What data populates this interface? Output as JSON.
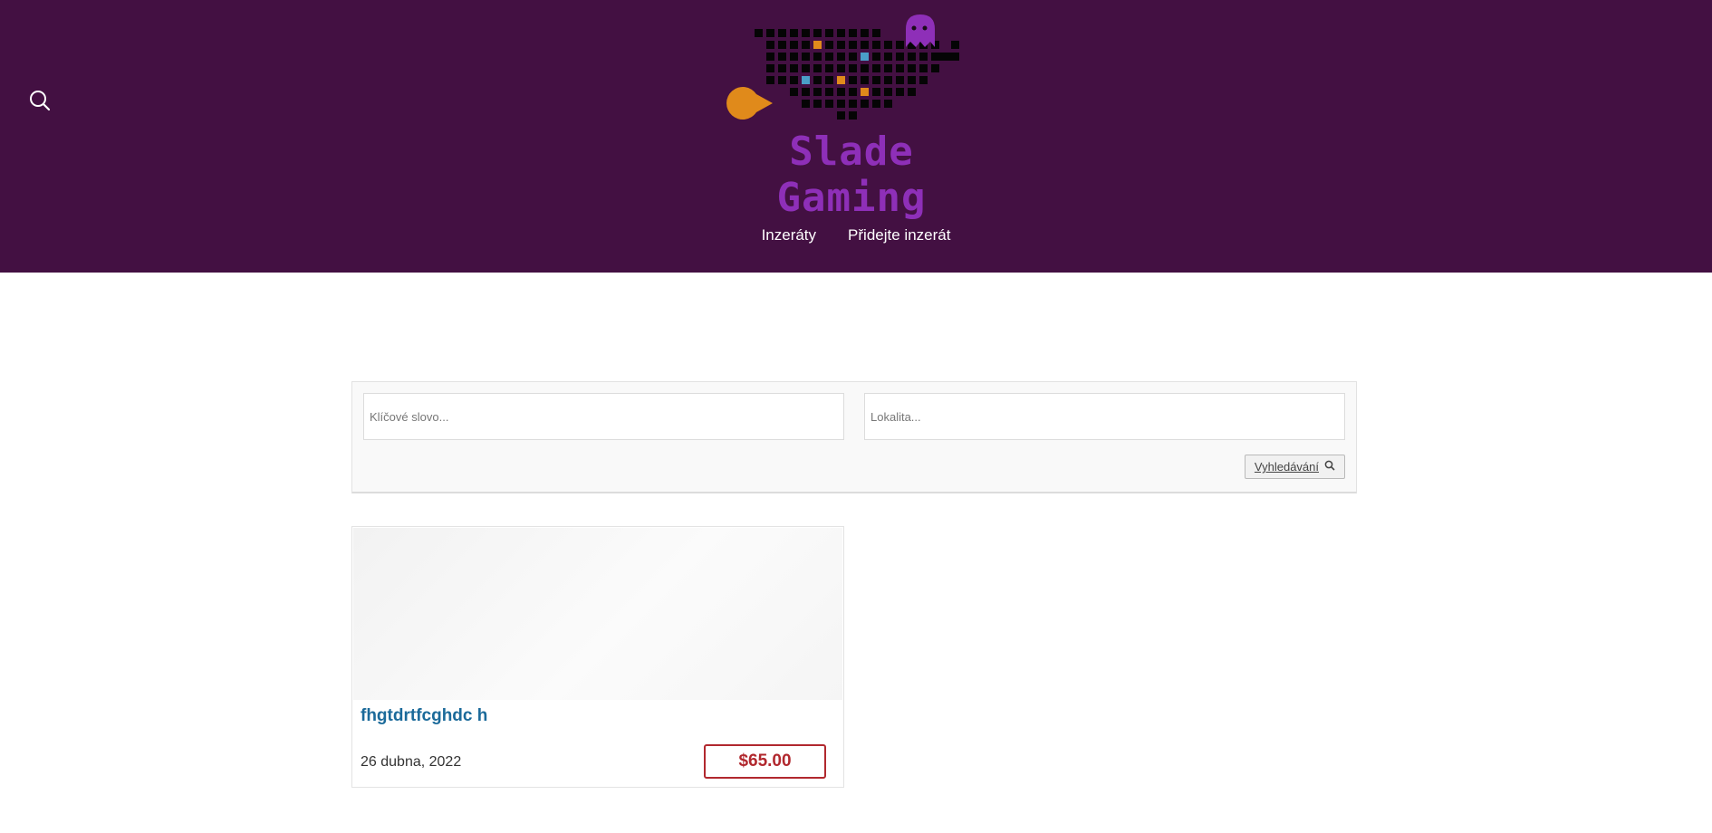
{
  "header": {
    "logo_text": "Slade Gaming",
    "background": "#431042",
    "accent": "#8e2fb8",
    "search_icon": "search-icon"
  },
  "nav": {
    "items": [
      {
        "label": "Inzeráty"
      },
      {
        "label": "Přidejte inzerát"
      }
    ]
  },
  "search": {
    "keyword_placeholder": "Klíčové slovo...",
    "location_placeholder": "Lokalita...",
    "button_label": "Vyhledávání",
    "button_icon": "search-icon"
  },
  "listings": [
    {
      "title": "fhgtdrtfcghdc h",
      "date": "26 dubna, 2022",
      "price": "$65.00"
    }
  ],
  "colors": {
    "link": "#1b6a9a",
    "price": "#b1282e"
  }
}
